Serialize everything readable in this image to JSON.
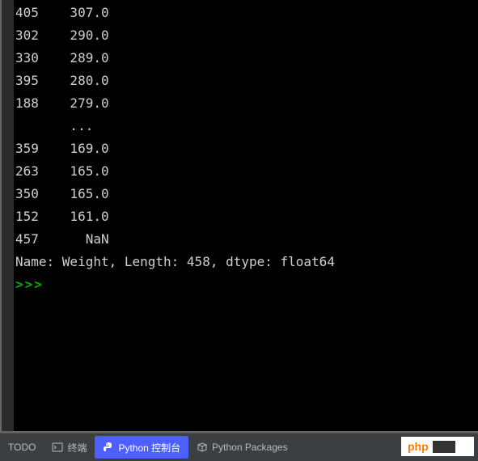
{
  "console": {
    "rows": [
      {
        "index": "405",
        "value": "307.0"
      },
      {
        "index": "302",
        "value": "290.0"
      },
      {
        "index": "330",
        "value": "289.0"
      },
      {
        "index": "395",
        "value": "280.0"
      },
      {
        "index": "188",
        "value": "279.0"
      },
      {
        "index": "   ",
        "value": "...  "
      },
      {
        "index": "359",
        "value": "169.0"
      },
      {
        "index": "263",
        "value": "165.0"
      },
      {
        "index": "350",
        "value": "165.0"
      },
      {
        "index": "152",
        "value": "161.0"
      },
      {
        "index": "457",
        "value": "  NaN"
      }
    ],
    "summary": "Name: Weight, Length: 458, dtype: float64",
    "prompt": ">>>"
  },
  "tabs": {
    "todo": "TODO",
    "terminal": "终端",
    "python_console": "Python 控制台",
    "python_packages": "Python Packages"
  },
  "watermark": {
    "text": "php"
  }
}
